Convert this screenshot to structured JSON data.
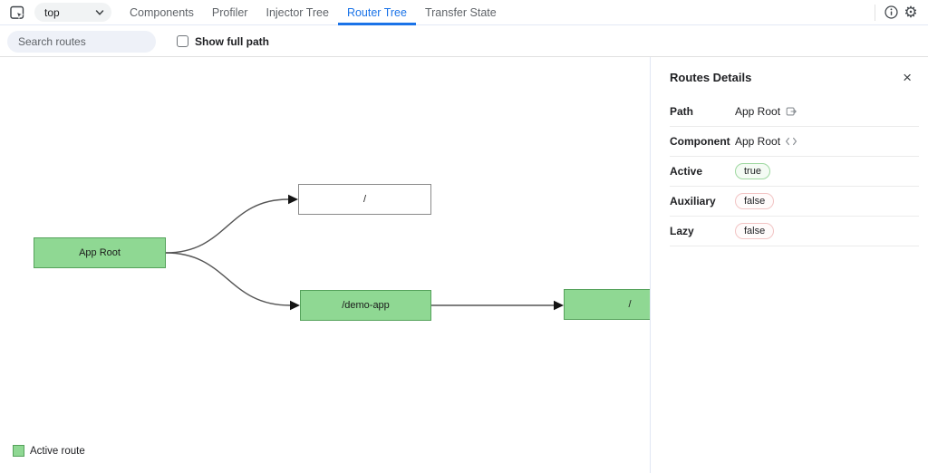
{
  "toolbar": {
    "frame_selector": {
      "value": "top"
    },
    "tabs": [
      {
        "label": "Components",
        "active": false
      },
      {
        "label": "Profiler",
        "active": false
      },
      {
        "label": "Injector Tree",
        "active": false
      },
      {
        "label": "Router Tree",
        "active": true
      },
      {
        "label": "Transfer State",
        "active": false
      }
    ]
  },
  "filter_bar": {
    "search_placeholder": "Search routes",
    "show_full_path": {
      "label": "Show full path",
      "checked": false
    }
  },
  "tree": {
    "nodes": [
      {
        "label": "App Root",
        "active": true
      },
      {
        "label": "/",
        "active": false
      },
      {
        "label": "/demo-app",
        "active": true
      },
      {
        "label": "/",
        "active": true
      }
    ]
  },
  "legend": {
    "active_route_label": "Active route"
  },
  "details_panel": {
    "title": "Routes Details",
    "rows": {
      "path": {
        "label": "Path",
        "value": "App Root",
        "icon": "navigate-icon"
      },
      "component": {
        "label": "Component",
        "value": "App Root",
        "icon": "code-icon"
      },
      "active": {
        "label": "Active",
        "value": "true",
        "status": "green"
      },
      "auxiliary": {
        "label": "Auxiliary",
        "value": "false",
        "status": "red"
      },
      "lazy": {
        "label": "Lazy",
        "value": "false",
        "status": "red"
      }
    }
  },
  "icons": {
    "close": "×",
    "settings": "⚙"
  },
  "colors": {
    "active_route_fill": "#8fd893",
    "active_route_border": "#55a25b",
    "tab_active_blue": "#1a73e8",
    "badge_true_border": "#9ed8a0",
    "badge_false_border": "#f2c4c4"
  }
}
